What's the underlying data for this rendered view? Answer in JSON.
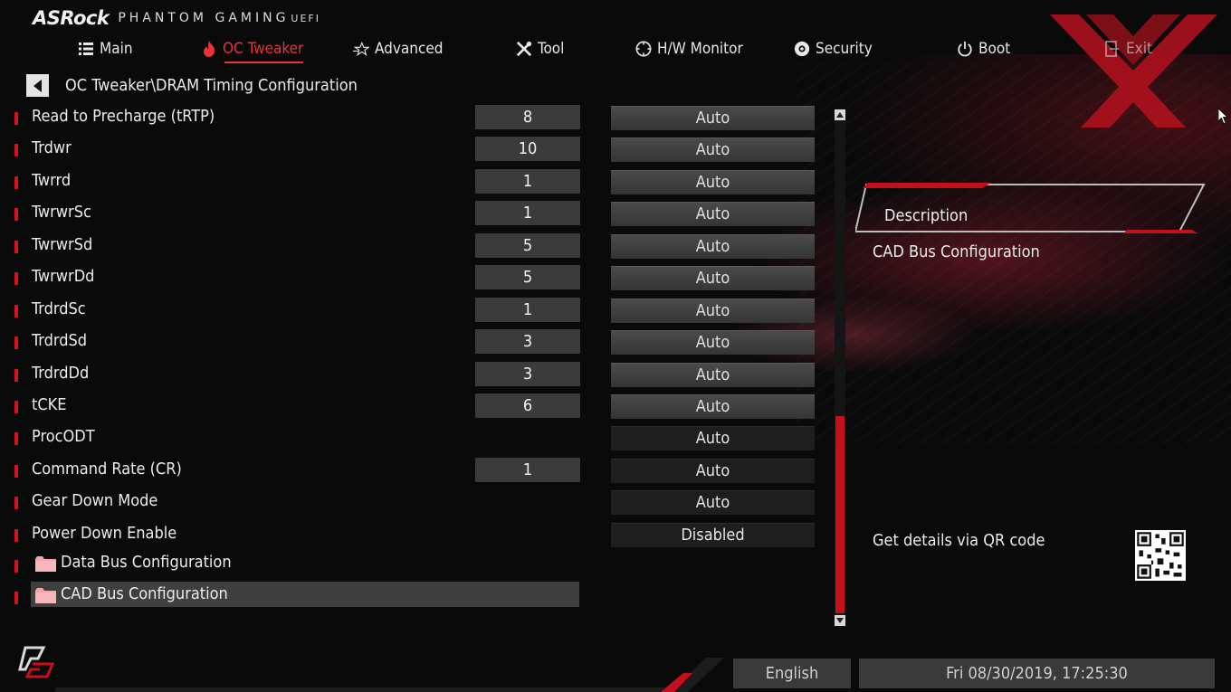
{
  "header": {
    "brand": "ASRock",
    "product": "PHANTOM GAMING",
    "uefi": "UEFI"
  },
  "nav": {
    "items": [
      {
        "label": "Main",
        "icon": "list-icon"
      },
      {
        "label": "OC Tweaker",
        "icon": "flame-icon",
        "active": true
      },
      {
        "label": "Advanced",
        "icon": "star-icon"
      },
      {
        "label": "Tool",
        "icon": "tools-icon"
      },
      {
        "label": "H/W Monitor",
        "icon": "monitor-icon"
      },
      {
        "label": "Security",
        "icon": "shield-icon"
      },
      {
        "label": "Boot",
        "icon": "power-icon"
      },
      {
        "label": "Exit",
        "icon": "exit-icon"
      }
    ]
  },
  "breadcrumb": "OC Tweaker\\DRAM Timing Configuration",
  "settings": [
    {
      "label": "Read to Precharge (tRTP)",
      "value": "8",
      "option": "Auto"
    },
    {
      "label": "Trdwr",
      "value": "10",
      "option": "Auto"
    },
    {
      "label": "Twrrd",
      "value": "1",
      "option": "Auto"
    },
    {
      "label": "TwrwrSc",
      "value": "1",
      "option": "Auto"
    },
    {
      "label": "TwrwrSd",
      "value": "5",
      "option": "Auto"
    },
    {
      "label": "TwrwrDd",
      "value": "5",
      "option": "Auto"
    },
    {
      "label": "TrdrdSc",
      "value": "1",
      "option": "Auto"
    },
    {
      "label": "TrdrdSd",
      "value": "3",
      "option": "Auto"
    },
    {
      "label": "TrdrdDd",
      "value": "3",
      "option": "Auto"
    },
    {
      "label": "tCKE",
      "value": "6",
      "option": "Auto"
    },
    {
      "label": "ProcODT",
      "option": "Auto"
    },
    {
      "label": "Command Rate (CR)",
      "value": "1",
      "option": "Auto"
    },
    {
      "label": "Gear Down Mode",
      "option": "Auto"
    },
    {
      "label": "Power Down Enable",
      "option": "Disabled"
    }
  ],
  "submenus": [
    {
      "label": "Data Bus Configuration",
      "selected": false
    },
    {
      "label": "CAD Bus Configuration",
      "selected": true
    }
  ],
  "description": {
    "title": "Description",
    "text": "CAD Bus Configuration",
    "qr_label": "Get details via QR code"
  },
  "footer": {
    "language": "English",
    "datetime": "Fri 08/30/2019, 17:25:30"
  },
  "colors": {
    "accent": "#d3131f",
    "active_tab": "#e8323c",
    "background": "#0a0a0b"
  }
}
